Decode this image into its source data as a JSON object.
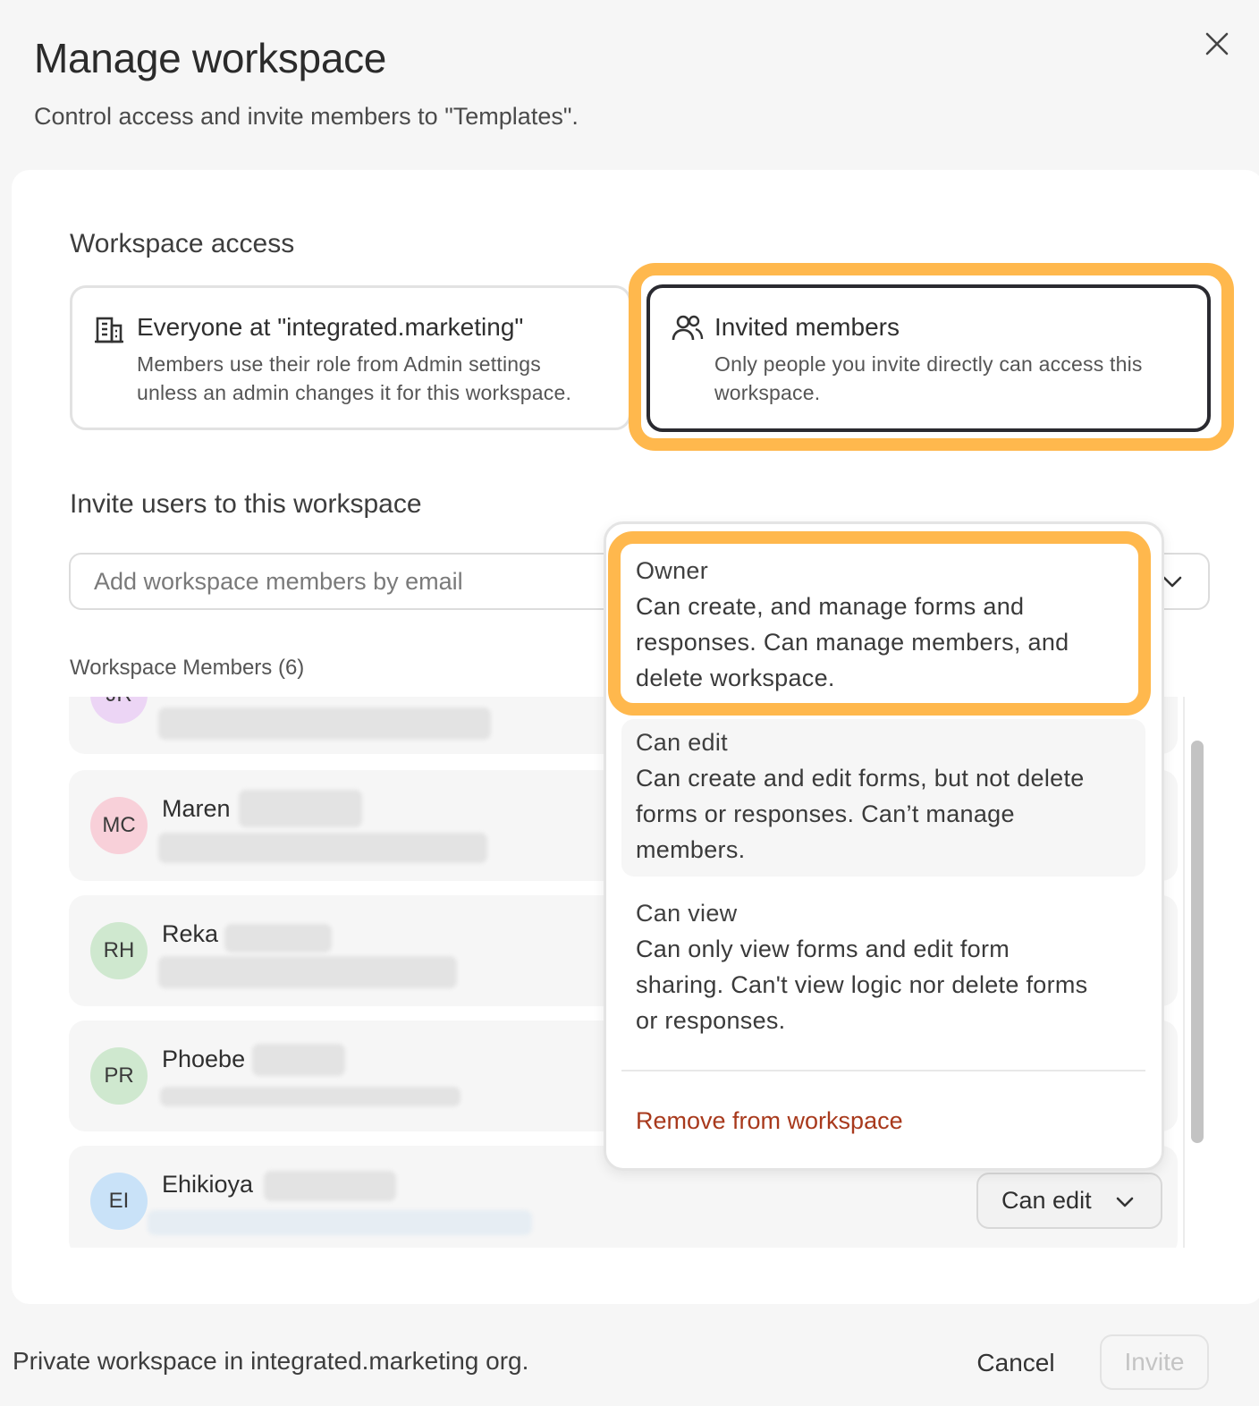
{
  "dialog": {
    "title": "Manage workspace",
    "subtitle": "Control access and invite members to \"Templates\"."
  },
  "access": {
    "heading": "Workspace access",
    "options": [
      {
        "title": "Everyone at \"integrated.marketing\"",
        "desc_line1": "Members use their role from Admin settings",
        "desc_line2": "unless an admin changes it for this workspace.",
        "icon": "building-icon",
        "selected": false
      },
      {
        "title": "Invited members",
        "desc_line1": "Only people you invite directly can access this",
        "desc_line2": "workspace.",
        "icon": "users-icon",
        "selected": true
      }
    ]
  },
  "invite": {
    "heading": "Invite users to this workspace",
    "placeholder": "Add workspace members by email"
  },
  "members": {
    "label": "Workspace Members (6)",
    "rows": [
      {
        "initials": "JR",
        "name": "",
        "avatar_color": "#ecd5f5"
      },
      {
        "initials": "MC",
        "name": "Maren",
        "avatar_color": "#f8d0d9"
      },
      {
        "initials": "RH",
        "name": "Reka",
        "avatar_color": "#cfe8cf"
      },
      {
        "initials": "PR",
        "name": "Phoebe",
        "avatar_color": "#cfe8cf"
      },
      {
        "initials": "EI",
        "name": "Ehikioya",
        "avatar_color": "#c9e2f8",
        "role": "Can edit"
      }
    ]
  },
  "role_menu": {
    "options": [
      {
        "title": "Owner",
        "lines": [
          "Can create, and manage forms and",
          "responses. Can manage members, and",
          "delete workspace."
        ]
      },
      {
        "title": "Can edit",
        "lines": [
          "Can create and edit forms, but not delete",
          "forms or responses. Can’t manage",
          "members."
        ]
      },
      {
        "title": "Can view",
        "lines": [
          "Can only view forms and edit form",
          "sharing. Can't view logic nor delete forms",
          "or responses."
        ]
      }
    ],
    "remove_label": "Remove from workspace"
  },
  "footer": {
    "note": "Private workspace in integrated.marketing org.",
    "cancel_label": "Cancel",
    "invite_label": "Invite"
  },
  "colors": {
    "highlight": "#ffb84d",
    "danger": "#a8391c",
    "selected_border": "#2a2a30"
  }
}
